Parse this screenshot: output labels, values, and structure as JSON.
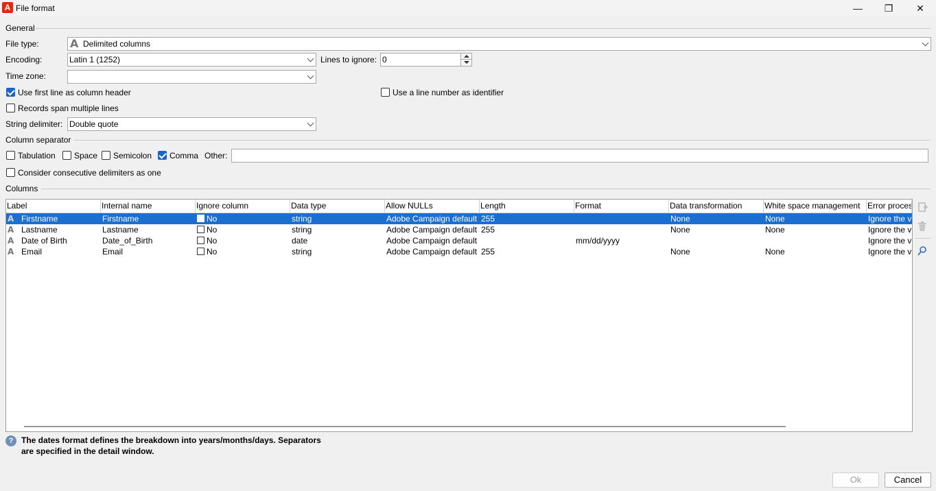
{
  "window": {
    "title": "File format",
    "app_icon_letter": "A",
    "minimize": "—",
    "maximize": "❐",
    "close": "✕"
  },
  "general": {
    "section_label": "General",
    "file_type_label": "File type:",
    "file_type_value": "Delimited columns",
    "encoding_label": "Encoding:",
    "encoding_value": "Latin 1 (1252)",
    "lines_to_ignore_label": "Lines to ignore:",
    "lines_to_ignore_value": "0",
    "time_zone_label": "Time zone:",
    "time_zone_value": "",
    "use_first_line_label": "Use first line as column header",
    "use_first_line_checked": true,
    "use_line_number_label": "Use a line number as identifier",
    "use_line_number_checked": false,
    "records_span_label": "Records span multiple lines",
    "records_span_checked": false,
    "string_delimiter_label": "String delimiter:",
    "string_delimiter_value": "Double quote"
  },
  "separator": {
    "section_label": "Column separator",
    "tabulation_label": "Tabulation",
    "tabulation_checked": false,
    "space_label": "Space",
    "space_checked": false,
    "semicolon_label": "Semicolon",
    "semicolon_checked": false,
    "comma_label": "Comma",
    "comma_checked": true,
    "other_label": "Other:",
    "other_value": "",
    "consecutive_label": "Consider consecutive delimiters as one",
    "consecutive_checked": false
  },
  "columns": {
    "section_label": "Columns",
    "headers": [
      "Label",
      "Internal name",
      "Ignore column",
      "Data type",
      "Allow NULLs",
      "Length",
      "Format",
      "Data transformation",
      "White space management",
      "Error process"
    ],
    "rows": [
      {
        "label": "Firstname",
        "internal_name": "Firstname",
        "ignore": "No",
        "data_type": "string",
        "allow_nulls": "Adobe Campaign default",
        "length": "255",
        "format": "",
        "transformation": "None",
        "white_space": "None",
        "error": "Ignore the v",
        "selected": true
      },
      {
        "label": "Lastname",
        "internal_name": "Lastname",
        "ignore": "No",
        "data_type": "string",
        "allow_nulls": "Adobe Campaign default",
        "length": "255",
        "format": "",
        "transformation": "None",
        "white_space": "None",
        "error": "Ignore the v",
        "selected": false
      },
      {
        "label": "Date of Birth",
        "internal_name": "Date_of_Birth",
        "ignore": "No",
        "data_type": "date",
        "allow_nulls": "Adobe Campaign default",
        "length": "",
        "format": "mm/dd/yyyy",
        "transformation": "",
        "white_space": "",
        "error": "Ignore the v",
        "selected": false
      },
      {
        "label": "Email",
        "internal_name": "Email",
        "ignore": "No",
        "data_type": "string",
        "allow_nulls": "Adobe Campaign default",
        "length": "255",
        "format": "",
        "transformation": "None",
        "white_space": "None",
        "error": "Ignore the v",
        "selected": false
      }
    ],
    "row_icon_letter": "A"
  },
  "side_tools": {
    "add_icon": "add-column-icon",
    "delete_icon": "trash-icon",
    "detail_icon": "magnifier-icon"
  },
  "info": {
    "line1": "The dates format defines the breakdown into years/months/days. Separators",
    "line2": "are specified in the detail window."
  },
  "buttons": {
    "ok": "Ok",
    "cancel": "Cancel"
  },
  "colors": {
    "selection": "#1a6fd0",
    "checkbox_on": "#1a64c8",
    "app_icon": "#e8250f"
  }
}
